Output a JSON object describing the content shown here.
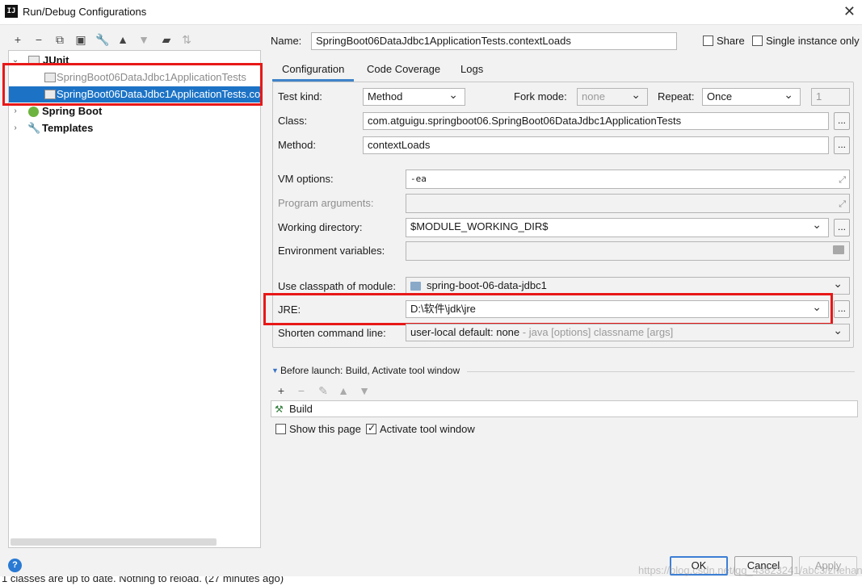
{
  "window": {
    "title": "Run/Debug Configurations",
    "logo": "IJ"
  },
  "left_toolbar": [
    "add-icon",
    "remove-icon",
    "copy-icon",
    "save-icon",
    "wrench-icon",
    "move-up-icon",
    "move-down-icon",
    "folder-icon",
    "sort-icon"
  ],
  "tree": {
    "junit": "JUnit",
    "item1": "SpringBoot06DataJdbc1ApplicationTests",
    "item2": "SpringBoot06DataJdbc1ApplicationTests.co",
    "springboot": "Spring Boot",
    "templates": "Templates"
  },
  "header": {
    "name_label": "Name:",
    "name_value": "SpringBoot06DataJdbc1ApplicationTests.contextLoads",
    "share_label": "Share",
    "share_checked": false,
    "single_label": "Single instance only",
    "single_checked": false
  },
  "tabs": [
    "Configuration",
    "Code Coverage",
    "Logs"
  ],
  "config": {
    "test_kind_label": "Test kind:",
    "test_kind_value": "Method",
    "fork_mode_label": "Fork mode:",
    "fork_mode_value": "none",
    "repeat_label": "Repeat:",
    "repeat_value": "Once",
    "repeat_count": "1",
    "class_label": "Class:",
    "class_value": "com.atguigu.springboot06.SpringBoot06DataJdbc1ApplicationTests",
    "method_label": "Method:",
    "method_value": "contextLoads",
    "vm_label": "VM options:",
    "vm_value": "-ea",
    "prog_label": "Program arguments:",
    "prog_value": "",
    "workdir_label": "Working directory:",
    "workdir_value": "$MODULE_WORKING_DIR$",
    "env_label": "Environment variables:",
    "env_value": "",
    "classpath_label": "Use classpath of module:",
    "classpath_value": "spring-boot-06-data-jdbc1",
    "jre_label": "JRE:",
    "jre_value": "D:\\软件\\jdk\\jre",
    "shorten_label": "Shorten command line:",
    "shorten_value": "user-local default: none",
    "shorten_hint": " - java [options] classname [args]",
    "dots": "..."
  },
  "before_launch": {
    "title": "Before launch: Build, Activate tool window",
    "item": "Build",
    "show_page_label": "Show this page",
    "show_page_checked": false,
    "activate_label": "Activate tool window",
    "activate_checked": true
  },
  "buttons": {
    "ok": "OK",
    "cancel": "Cancel",
    "apply": "Apply",
    "help": "?"
  },
  "status_text": "1 classes are up to date. Nothing to reload. (27 minutes ago)",
  "watermark": "https://blog.csdn.net/qq_43823241/abc3/zhehang"
}
